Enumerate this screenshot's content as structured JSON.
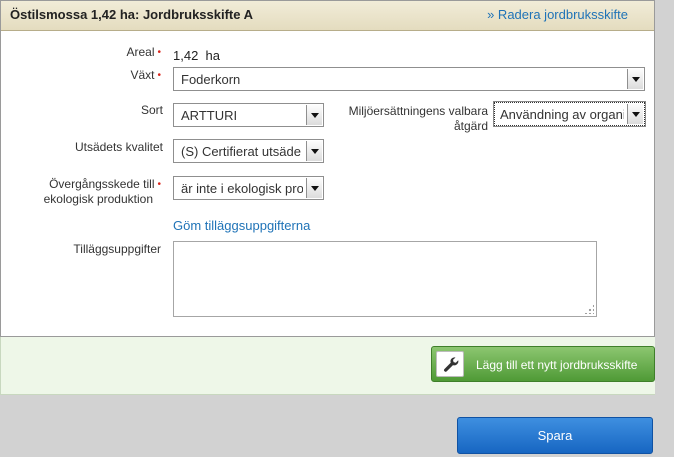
{
  "header": {
    "title": "Östilsmossa 1,42 ha: Jordbruksskifte A",
    "delete_link": "» Radera jordbruksskifte"
  },
  "form": {
    "area": {
      "label": "Areal",
      "value": "1,42",
      "unit": "ha"
    },
    "crop": {
      "label": "Växt",
      "selected": "Foderkorn"
    },
    "variety": {
      "label": "Sort",
      "selected": "ARTTURI"
    },
    "environmental_measure": {
      "label_line1": "Miljöersättningens valbara",
      "label_line2": "åtgärd",
      "selected": "Användning av organis"
    },
    "seed_quality": {
      "label": "Utsädets kvalitet",
      "selected": "(S) Certifierat utsäde"
    },
    "transition_stage": {
      "label_line1": "Övergångsskede till",
      "label_line2": "ekologisk produktion",
      "selected": "är inte i ekologisk prod"
    },
    "hide_extra_link": "Göm tilläggsuppgifterna",
    "extra_info": {
      "label": "Tilläggsuppgifter",
      "value": ""
    },
    "required_mark": "•"
  },
  "actions": {
    "add_parcel": "Lägg till ett nytt jordbruksskifte",
    "save": "Spara"
  },
  "colors": {
    "link": "#1f73b7",
    "required": "#d9261c",
    "add_button": "#5aa53e",
    "save_button": "#1f6fcc",
    "header_bg": "#e8e0c4"
  },
  "icons": {
    "add_parcel": "wrench-icon",
    "select_arrow": "chevron-down-icon"
  }
}
